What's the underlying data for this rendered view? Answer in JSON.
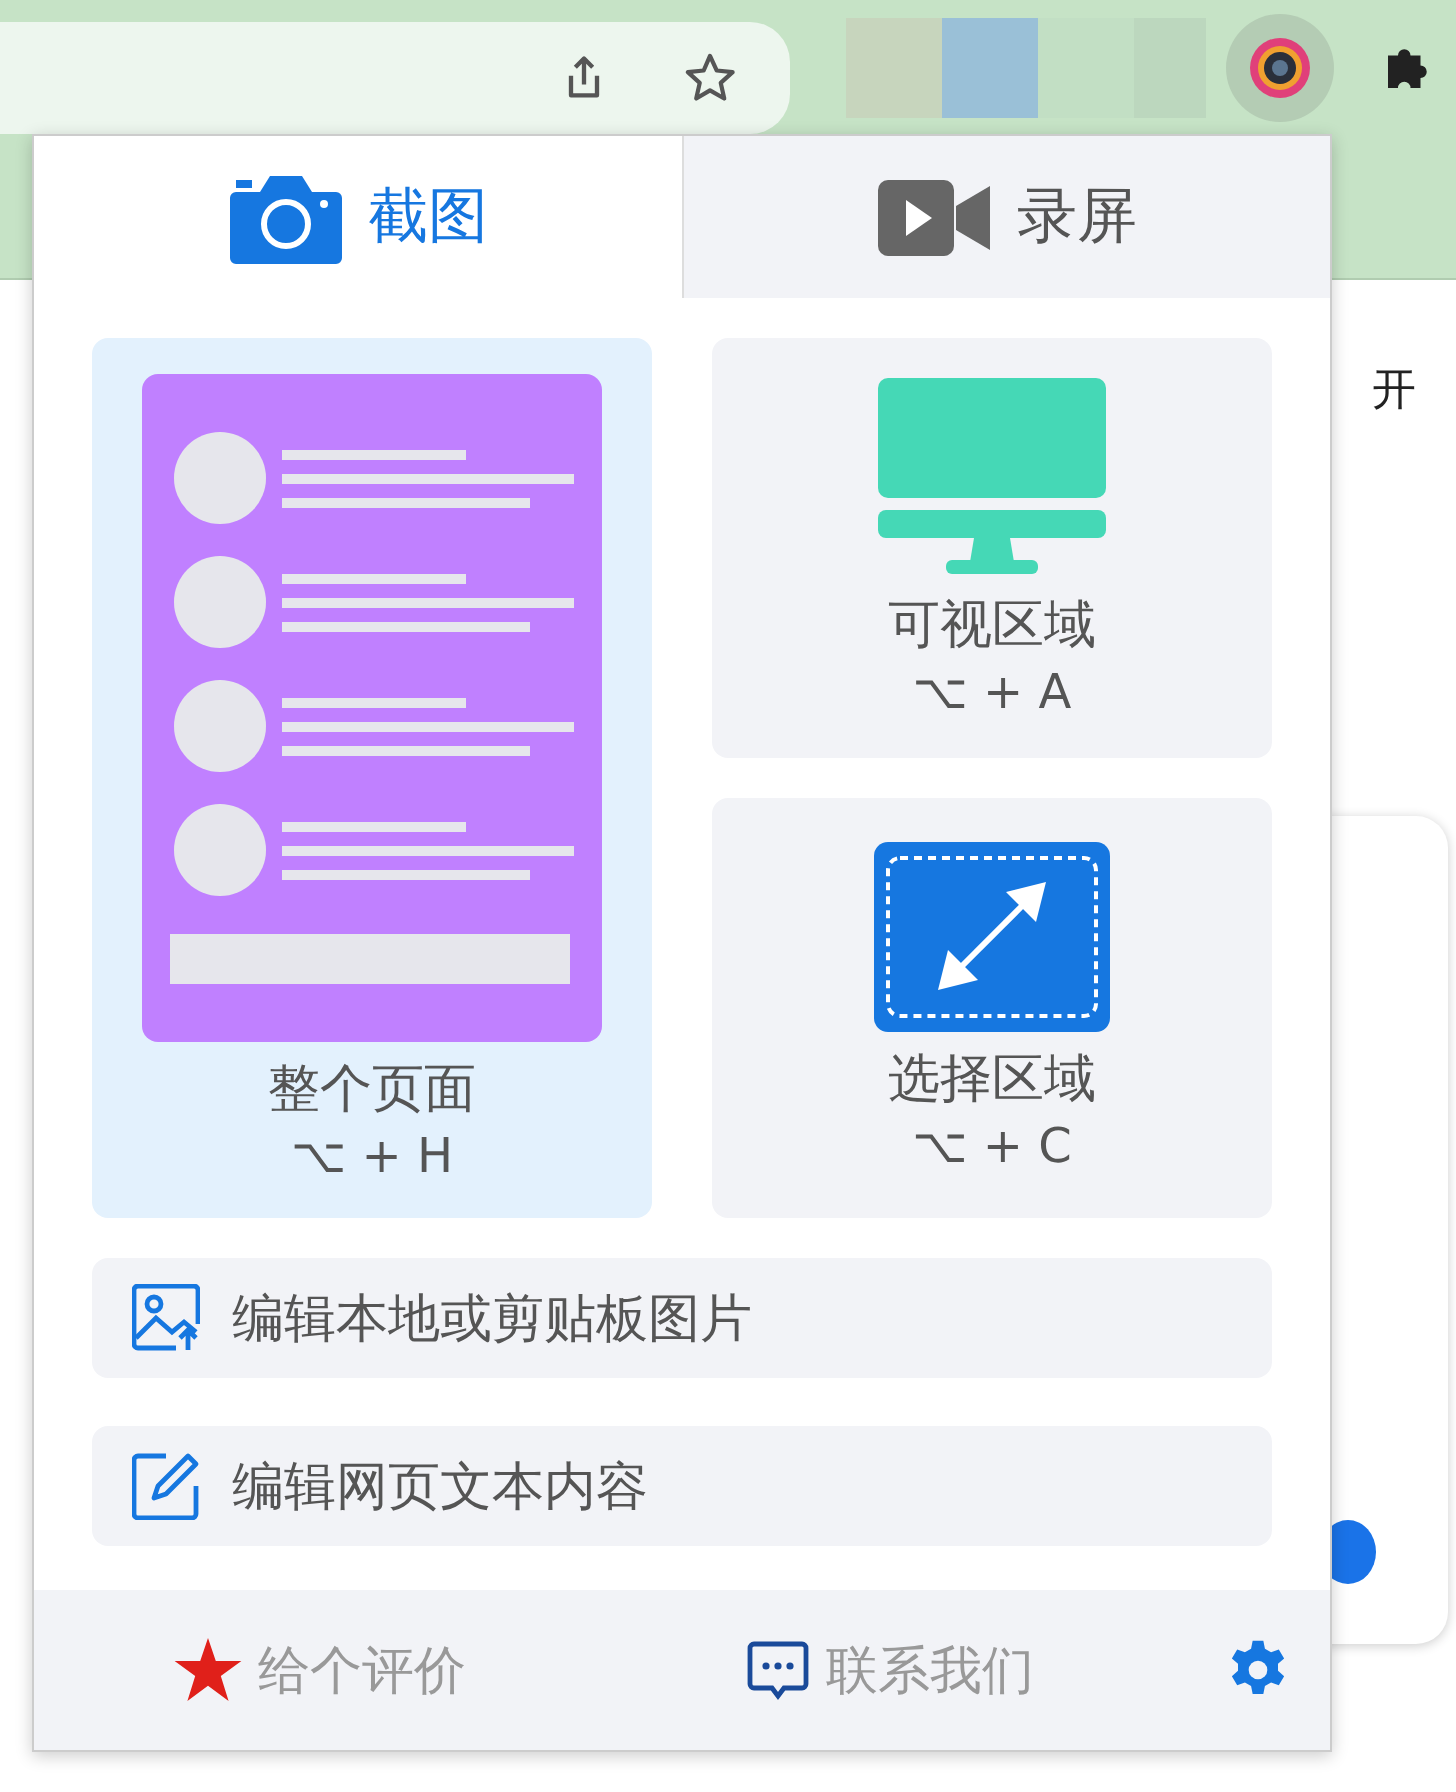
{
  "page": {
    "side_text": "开"
  },
  "popup": {
    "tabs": [
      {
        "label": "截图",
        "selected": true,
        "kind": "camera"
      },
      {
        "label": "录屏",
        "selected": false,
        "kind": "video"
      }
    ],
    "capture_options": [
      {
        "kind": "page",
        "label": "整个页面",
        "shortcut": "⌥ + H",
        "selected": true
      },
      {
        "kind": "monitor",
        "label": "可视区域",
        "shortcut": "⌥ + A",
        "selected": false
      },
      {
        "kind": "select",
        "label": "选择区域",
        "shortcut": "⌥ + C",
        "selected": false
      }
    ],
    "actions": [
      {
        "kind": "image",
        "label": "编辑本地或剪贴板图片"
      },
      {
        "kind": "edit",
        "label": "编辑网页文本内容"
      }
    ],
    "footer": [
      {
        "kind": "star",
        "label": "给个评价"
      },
      {
        "kind": "chat",
        "label": "联系我们"
      }
    ]
  }
}
